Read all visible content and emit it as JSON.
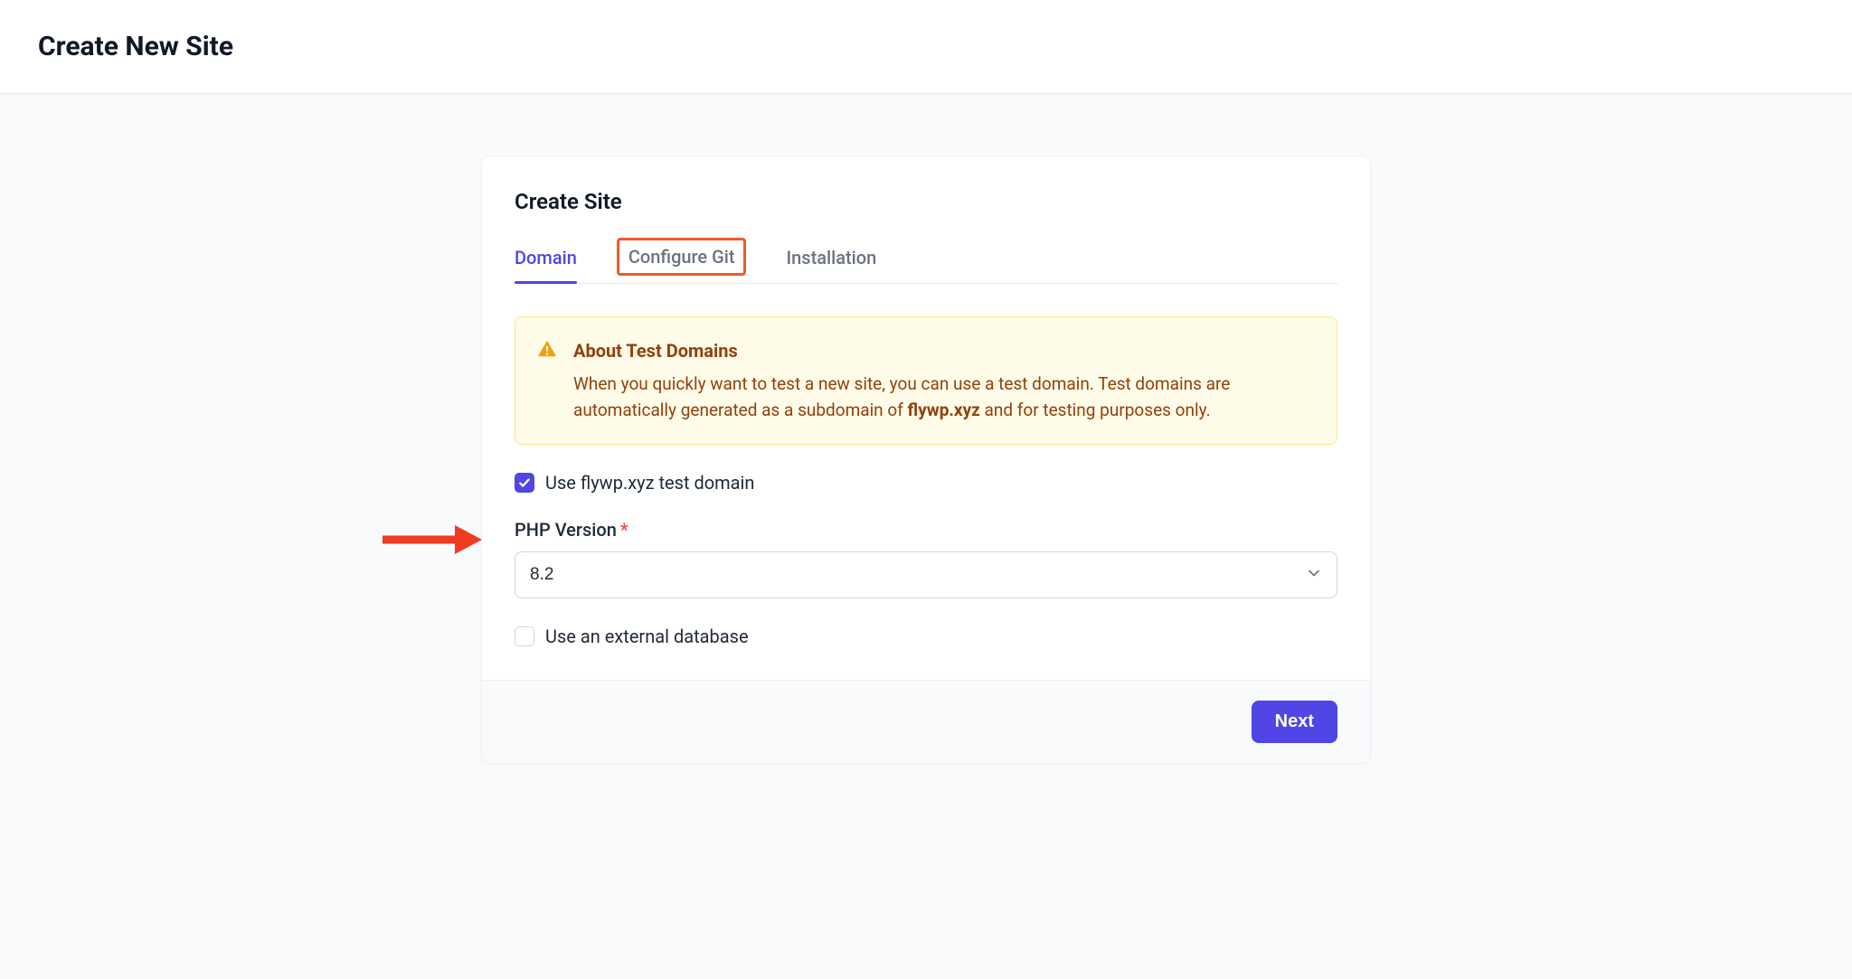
{
  "header": {
    "title": "Create New Site"
  },
  "card": {
    "title": "Create Site",
    "tabs": [
      {
        "label": "Domain",
        "active": true
      },
      {
        "label": "Configure Git",
        "active": false,
        "highlighted": true
      },
      {
        "label": "Installation",
        "active": false
      }
    ],
    "alert": {
      "title": "About Test Domains",
      "text_pre": "When you quickly want to test a new site, you can use a test domain. Test domains are automatically generated as a subdomain of ",
      "text_bold": "flywp.xyz",
      "text_post": " and for testing purposes only."
    },
    "test_domain_checkbox": {
      "label": "Use flywp.xyz test domain",
      "checked": true
    },
    "php_version": {
      "label": "PHP Version",
      "required": true,
      "value": "8.2"
    },
    "external_db_checkbox": {
      "label": "Use an external database",
      "checked": false
    },
    "footer": {
      "next_label": "Next"
    }
  }
}
